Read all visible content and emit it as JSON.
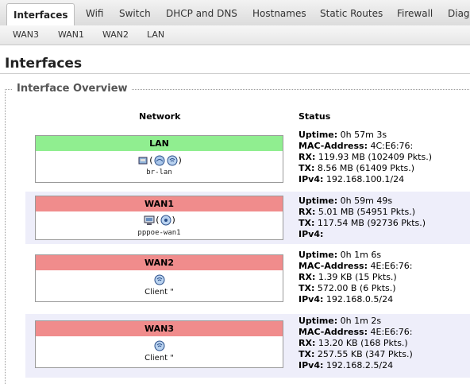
{
  "tabs": [
    "Interfaces",
    "Wifi",
    "Switch",
    "DHCP and DNS",
    "Hostnames",
    "Static Routes",
    "Firewall",
    "Diag"
  ],
  "subtabs": [
    "WAN3",
    "WAN1",
    "WAN2",
    "LAN"
  ],
  "page": {
    "title": "Interfaces"
  },
  "section": {
    "legend": "Interface Overview",
    "col_network": "Network",
    "col_status": "Status"
  },
  "colors": {
    "up": "#90ee90",
    "down": "#f08c8c",
    "row_alt": "#eeeefa"
  },
  "interfaces": [
    {
      "name": "LAN",
      "state": "up",
      "icons": [
        "ethernet-icon",
        "bridge-icon"
      ],
      "icon_text": "()",
      "device": "br-lan",
      "client": "",
      "status": {
        "uptime_label": "Uptime:",
        "uptime": "0h 57m 3s",
        "mac_label": "MAC-Address:",
        "mac": "4C:E6:76:",
        "rx_label": "RX:",
        "rx": "119.93 MB (102409 Pkts.)",
        "tx_label": "TX:",
        "tx": "8.56 MB (61409 Pkts.)",
        "ipv4_label": "IPv4:",
        "ipv4": "192.168.100.1/24"
      }
    },
    {
      "name": "WAN1",
      "state": "down",
      "icons": [
        "modem-icon",
        "pppoe-icon"
      ],
      "icon_text": "()",
      "device": "pppoe-wan1",
      "client": "",
      "status": {
        "uptime_label": "Uptime:",
        "uptime": "0h 59m 49s",
        "rx_label": "RX:",
        "rx": "5.01 MB (54951 Pkts.)",
        "tx_label": "TX:",
        "tx": "117.54 MB (92736 Pkts.)",
        "ipv4_label": "IPv4:",
        "ipv4": ""
      }
    },
    {
      "name": "WAN2",
      "state": "down",
      "icons": [
        "wifi-icon"
      ],
      "icon_text": "",
      "device": "",
      "client": "Client \"",
      "status": {
        "uptime_label": "Uptime:",
        "uptime": "0h 1m 6s",
        "mac_label": "MAC-Address:",
        "mac": "4E:E6:76:",
        "rx_label": "RX:",
        "rx": "1.39 KB (15 Pkts.)",
        "tx_label": "TX:",
        "tx": "572.00 B (6 Pkts.)",
        "ipv4_label": "IPv4:",
        "ipv4": "192.168.0.5/24"
      }
    },
    {
      "name": "WAN3",
      "state": "down",
      "icons": [
        "wifi-icon"
      ],
      "icon_text": "",
      "device": "",
      "client": "Client \"",
      "status": {
        "uptime_label": "Uptime:",
        "uptime": "0h 1m 2s",
        "mac_label": "MAC-Address:",
        "mac": "4E:E6:76:",
        "rx_label": "RX:",
        "rx": "13.20 KB (168 Pkts.)",
        "tx_label": "TX:",
        "tx": "257.55 KB (347 Pkts.)",
        "ipv4_label": "IPv4:",
        "ipv4": "192.168.2.5/24"
      }
    }
  ]
}
